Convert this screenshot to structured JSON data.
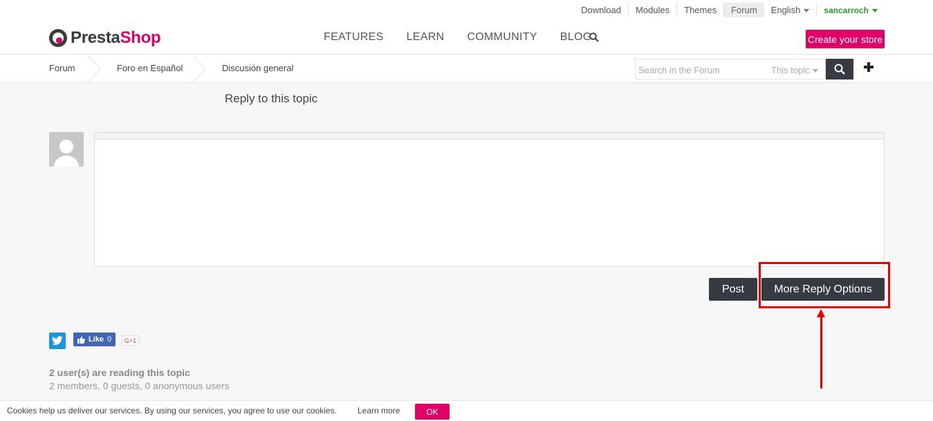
{
  "topbar": {
    "links": [
      "Download",
      "Modules",
      "Themes",
      "Forum"
    ],
    "language": "English",
    "username": "sancarroch"
  },
  "logo": {
    "part1": "Presta",
    "part2": "Shop"
  },
  "mainnav": [
    "FEATURES",
    "LEARN",
    "COMMUNITY",
    "BLOG"
  ],
  "create_store": "Create your store",
  "breadcrumb": [
    "Forum",
    "Foro en Español",
    "Discusión general"
  ],
  "forum_search": {
    "placeholder": "Search in the Forum",
    "scope": "This topic"
  },
  "reply": {
    "title": "Reply to this topic",
    "post_label": "Post",
    "more_label": "More Reply Options"
  },
  "social": {
    "like_label": "Like",
    "like_count": "0",
    "gplus_label": "G+1"
  },
  "readers": {
    "headline": "2 user(s) are reading this topic",
    "detail": "2 members, 0 guests, 0 anonymous users"
  },
  "cookie": {
    "message": "Cookies help us deliver our services. By using our services, you agree to use our cookies.",
    "learn_more": "Learn more",
    "ok": "OK"
  },
  "colors": {
    "brand": "#df0067",
    "dark": "#363a41",
    "annotation": "#ee0000",
    "user": "#2b9a2b"
  },
  "icons": [
    "search-icon",
    "plus-icon",
    "twitter-icon",
    "facebook-icon",
    "avatar-placeholder-icon"
  ]
}
